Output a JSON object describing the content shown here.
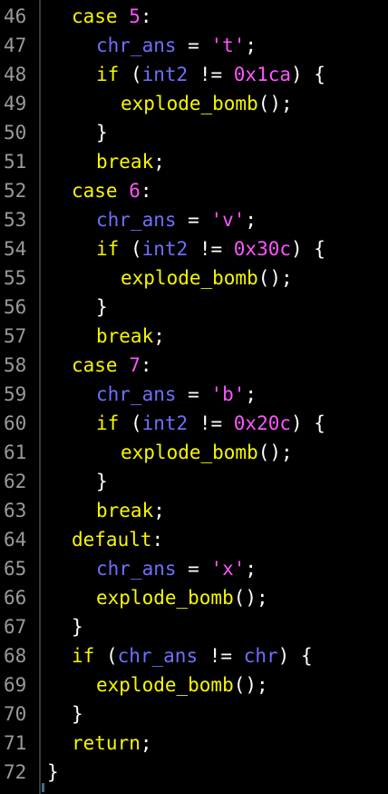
{
  "editor": {
    "lines": [
      {
        "n": "46",
        "indent": 1,
        "tokens": [
          [
            "kw",
            "case"
          ],
          [
            "p",
            " "
          ],
          [
            "num",
            "5"
          ],
          [
            "p",
            ":"
          ]
        ]
      },
      {
        "n": "47",
        "indent": 2,
        "tokens": [
          [
            "id",
            "chr_ans"
          ],
          [
            "p",
            " "
          ],
          [
            "op",
            "="
          ],
          [
            "p",
            " "
          ],
          [
            "str",
            "'t'"
          ],
          [
            "p",
            ";"
          ]
        ]
      },
      {
        "n": "48",
        "indent": 2,
        "tokens": [
          [
            "kw",
            "if"
          ],
          [
            "p",
            " ("
          ],
          [
            "id",
            "int2"
          ],
          [
            "p",
            " "
          ],
          [
            "op",
            "!="
          ],
          [
            "p",
            " "
          ],
          [
            "num",
            "0x1ca"
          ],
          [
            "p",
            ") {"
          ]
        ]
      },
      {
        "n": "49",
        "indent": 3,
        "tokens": [
          [
            "fn",
            "explode_bomb"
          ],
          [
            "p",
            "();"
          ]
        ]
      },
      {
        "n": "50",
        "indent": 2,
        "tokens": [
          [
            "p",
            "}"
          ]
        ]
      },
      {
        "n": "51",
        "indent": 2,
        "tokens": [
          [
            "kw",
            "break"
          ],
          [
            "p",
            ";"
          ]
        ]
      },
      {
        "n": "52",
        "indent": 1,
        "tokens": [
          [
            "kw",
            "case"
          ],
          [
            "p",
            " "
          ],
          [
            "num",
            "6"
          ],
          [
            "p",
            ":"
          ]
        ]
      },
      {
        "n": "53",
        "indent": 2,
        "tokens": [
          [
            "id",
            "chr_ans"
          ],
          [
            "p",
            " "
          ],
          [
            "op",
            "="
          ],
          [
            "p",
            " "
          ],
          [
            "str",
            "'v'"
          ],
          [
            "p",
            ";"
          ]
        ]
      },
      {
        "n": "54",
        "indent": 2,
        "tokens": [
          [
            "kw",
            "if"
          ],
          [
            "p",
            " ("
          ],
          [
            "id",
            "int2"
          ],
          [
            "p",
            " "
          ],
          [
            "op",
            "!="
          ],
          [
            "p",
            " "
          ],
          [
            "num",
            "0x30c"
          ],
          [
            "p",
            ") {"
          ]
        ]
      },
      {
        "n": "55",
        "indent": 3,
        "tokens": [
          [
            "fn",
            "explode_bomb"
          ],
          [
            "p",
            "();"
          ]
        ]
      },
      {
        "n": "56",
        "indent": 2,
        "tokens": [
          [
            "p",
            "}"
          ]
        ]
      },
      {
        "n": "57",
        "indent": 2,
        "tokens": [
          [
            "kw",
            "break"
          ],
          [
            "p",
            ";"
          ]
        ]
      },
      {
        "n": "58",
        "indent": 1,
        "tokens": [
          [
            "kw",
            "case"
          ],
          [
            "p",
            " "
          ],
          [
            "num",
            "7"
          ],
          [
            "p",
            ":"
          ]
        ]
      },
      {
        "n": "59",
        "indent": 2,
        "tokens": [
          [
            "id",
            "chr_ans"
          ],
          [
            "p",
            " "
          ],
          [
            "op",
            "="
          ],
          [
            "p",
            " "
          ],
          [
            "str",
            "'b'"
          ],
          [
            "p",
            ";"
          ]
        ]
      },
      {
        "n": "60",
        "indent": 2,
        "tokens": [
          [
            "kw",
            "if"
          ],
          [
            "p",
            " ("
          ],
          [
            "id",
            "int2"
          ],
          [
            "p",
            " "
          ],
          [
            "op",
            "!="
          ],
          [
            "p",
            " "
          ],
          [
            "num",
            "0x20c"
          ],
          [
            "p",
            ") {"
          ]
        ]
      },
      {
        "n": "61",
        "indent": 3,
        "tokens": [
          [
            "fn",
            "explode_bomb"
          ],
          [
            "p",
            "();"
          ]
        ]
      },
      {
        "n": "62",
        "indent": 2,
        "tokens": [
          [
            "p",
            "}"
          ]
        ]
      },
      {
        "n": "63",
        "indent": 2,
        "tokens": [
          [
            "kw",
            "break"
          ],
          [
            "p",
            ";"
          ]
        ]
      },
      {
        "n": "64",
        "indent": 1,
        "tokens": [
          [
            "kw",
            "default"
          ],
          [
            "p",
            ":"
          ]
        ]
      },
      {
        "n": "65",
        "indent": 2,
        "tokens": [
          [
            "id",
            "chr_ans"
          ],
          [
            "p",
            " "
          ],
          [
            "op",
            "="
          ],
          [
            "p",
            " "
          ],
          [
            "str",
            "'x'"
          ],
          [
            "p",
            ";"
          ]
        ]
      },
      {
        "n": "66",
        "indent": 2,
        "tokens": [
          [
            "fn",
            "explode_bomb"
          ],
          [
            "p",
            "();"
          ]
        ]
      },
      {
        "n": "67",
        "indent": 1,
        "tokens": [
          [
            "p",
            "}"
          ]
        ]
      },
      {
        "n": "68",
        "indent": 1,
        "tokens": [
          [
            "kw",
            "if"
          ],
          [
            "p",
            " ("
          ],
          [
            "id",
            "chr_ans"
          ],
          [
            "p",
            " "
          ],
          [
            "op",
            "!="
          ],
          [
            "p",
            " "
          ],
          [
            "id",
            "chr"
          ],
          [
            "p",
            ") {"
          ]
        ]
      },
      {
        "n": "69",
        "indent": 2,
        "tokens": [
          [
            "fn",
            "explode_bomb"
          ],
          [
            "p",
            "();"
          ]
        ]
      },
      {
        "n": "70",
        "indent": 1,
        "tokens": [
          [
            "p",
            "}"
          ]
        ]
      },
      {
        "n": "71",
        "indent": 1,
        "tokens": [
          [
            "kw",
            "return"
          ],
          [
            "p",
            ";"
          ]
        ]
      },
      {
        "n": "72",
        "indent": 0,
        "tokens": [
          [
            "p",
            "}"
          ]
        ]
      }
    ]
  },
  "colors": {
    "background": "#000000",
    "line_number": "#9a9a9a",
    "keyword": "#f7f700",
    "identifier": "#6f6fff",
    "literal": "#ff55ff",
    "punctuation": "#ffffff"
  }
}
